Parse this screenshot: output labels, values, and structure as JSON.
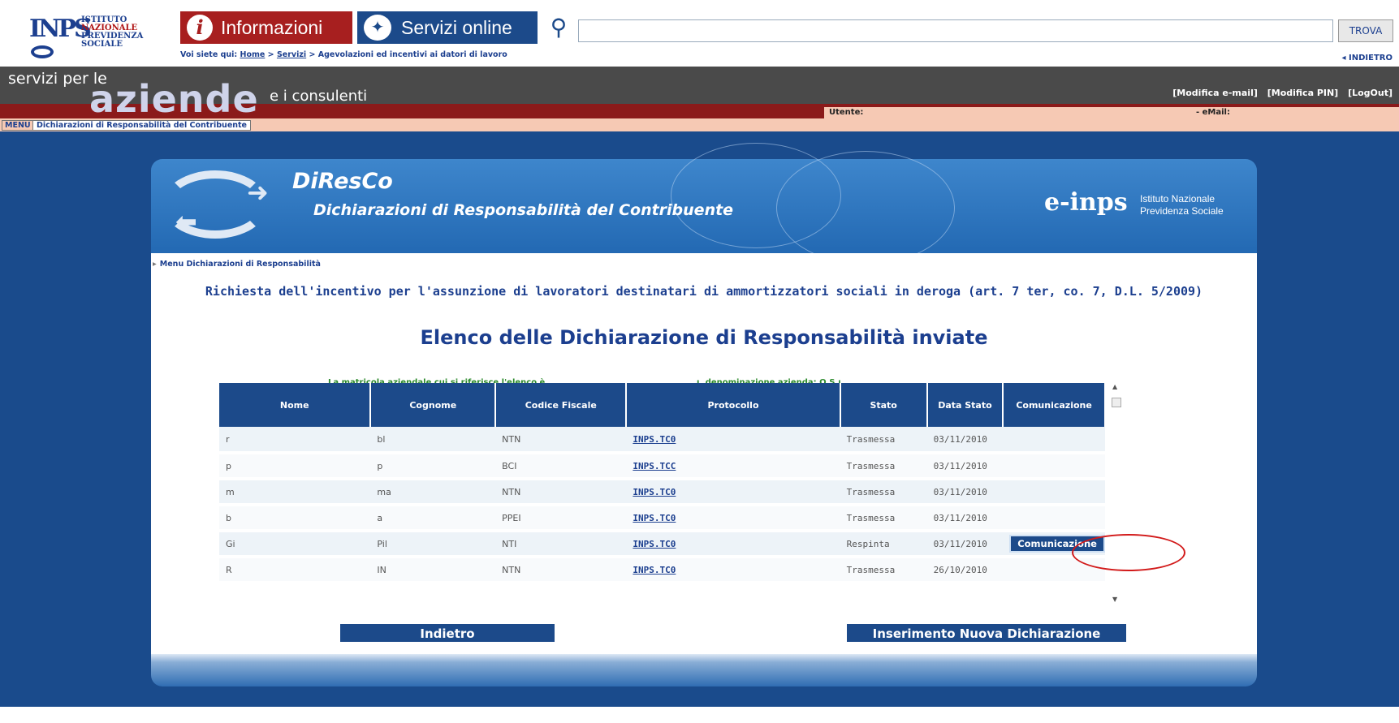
{
  "logo": {
    "mark": "INPS",
    "lines": [
      "ISTITUTO",
      "NAZIONALE",
      "PREVIDENZA",
      "SOCIALE"
    ]
  },
  "nav": {
    "info_label": "Informazioni",
    "services_label": "Servizi online",
    "search_button": "TROVA",
    "back_link": "◂ INDIETRO"
  },
  "breadcrumb": {
    "prefix": "Voi siete qui:",
    "home": "Home",
    "sep": ">",
    "servizi": "Servizi",
    "current": "> Agevolazioni ed incentivi ai datori di lavoro"
  },
  "header": {
    "small": "servizi per le",
    "big": "aziende",
    "tail": "e i consulenti",
    "links": [
      "[Modifica e-mail]",
      "[Modifica PIN]",
      "[LogOut]"
    ],
    "user_label": "Utente:",
    "email_label": "- eMail:"
  },
  "menu": {
    "menu_btn": "MENU",
    "tab": "Dichiarazioni di Responsabilità del Contribuente"
  },
  "app": {
    "title": "DiResCo",
    "subtitle": "Dichiarazioni di Responsabilità del Contribuente",
    "einps": "e-inps",
    "inst_line1": "Istituto Nazionale",
    "inst_line2": "Previdenza Sociale"
  },
  "page": {
    "menu_link": "Menu Dichiarazioni di Responsabilità",
    "request": "Richiesta dell'incentivo per l'assunzione di lavoratori destinatari di ammortizzatori sociali in deroga (art. 7 ter, co. 7, D.L. 5/2009)",
    "list_title": "Elenco delle Dichiarazione di Responsabilità inviate",
    "matricola": "La matricola aziendale cui si riferisce l'elenco è",
    "azienda": "ı, denominazione azienda: O.S.ı"
  },
  "table": {
    "columns": [
      "Nome",
      "Cognome",
      "Codice Fiscale",
      "Protocollo",
      "Stato",
      "Data Stato",
      "Comunicazione"
    ],
    "rows": [
      {
        "nome": "r",
        "cognome": "bl",
        "cf": "NTN",
        "prot": "INPS.TC0",
        "stato": "Trasmessa",
        "data": "03/11/2010",
        "comm": ""
      },
      {
        "nome": "p",
        "cognome": "p",
        "cf": "BCI",
        "prot": "INPS.TCC",
        "stato": "Trasmessa",
        "data": "03/11/2010",
        "comm": ""
      },
      {
        "nome": "m",
        "cognome": "ma",
        "cf": "NTN",
        "prot": "INPS.TC0",
        "stato": "Trasmessa",
        "data": "03/11/2010",
        "comm": ""
      },
      {
        "nome": "b",
        "cognome": "a",
        "cf": "PPEI",
        "prot": "INPS.TC0",
        "stato": "Trasmessa",
        "data": "03/11/2010",
        "comm": ""
      },
      {
        "nome": "Gi",
        "cognome": "Pil",
        "cf": "NTI",
        "prot": "INPS.TC0",
        "stato": "Respinta",
        "data": "03/11/2010",
        "comm": "Comunicazione"
      },
      {
        "nome": "R",
        "cognome": "IN",
        "cf": "NTN",
        "prot": "INPS.TC0",
        "stato": "Trasmessa",
        "data": "26/10/2010",
        "comm": ""
      }
    ]
  },
  "buttons": {
    "back": "Indietro",
    "new": "Inserimento Nuova Dichiarazione"
  },
  "colors": {
    "inps_blue": "#1c4a8a",
    "inps_red": "#a71f1f",
    "highlight_red": "#d21a1a"
  }
}
